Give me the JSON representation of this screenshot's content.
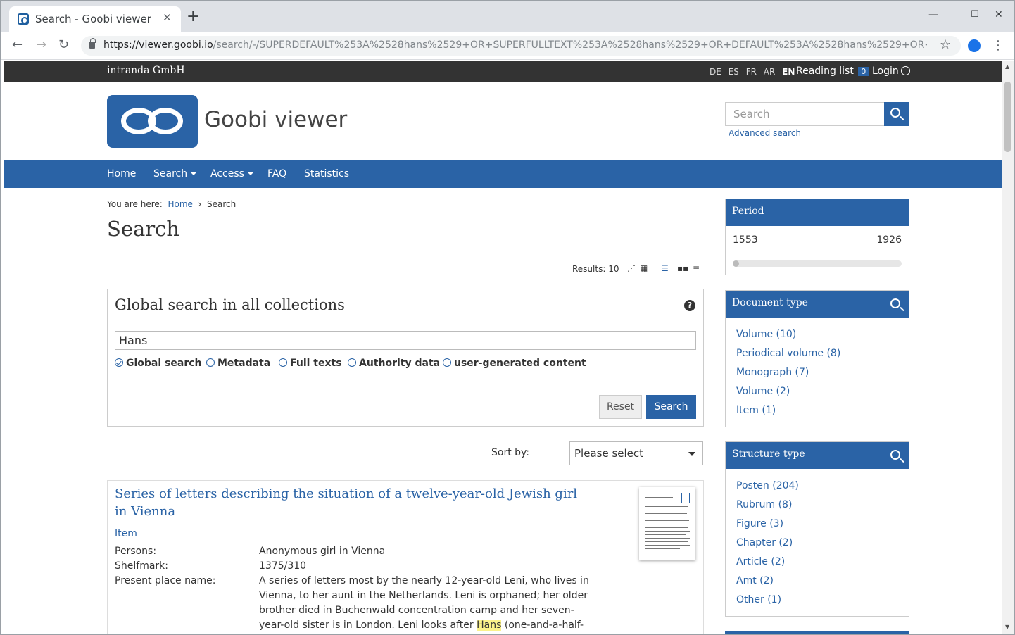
{
  "browser": {
    "tab_title": "Search - Goobi viewer",
    "url_host": "https://viewer.goobi.io",
    "url_path": "/search/-/SUPERDEFAULT%253A%2528hans%2529+OR+SUPERFULLTEXT%253A%2528hans%2529+OR+DEFAULT%253A%2528hans%2529+OR+FULLTEXT%253A%2..."
  },
  "topbar": {
    "brand": "intranda GmbH",
    "languages": [
      "DE",
      "ES",
      "FR",
      "AR",
      "EN"
    ],
    "active_language": "EN",
    "reading_list_label": "Reading list",
    "reading_list_count": "0",
    "login_label": "Login"
  },
  "header": {
    "site_name": "Goobi viewer",
    "search_placeholder": "Search",
    "advanced_search": "Advanced search"
  },
  "nav": {
    "items": [
      "Home",
      "Search",
      "Access",
      "FAQ",
      "Statistics"
    ]
  },
  "breadcrumb": {
    "prefix": "You are here:",
    "home": "Home",
    "separator": "›",
    "current": "Search"
  },
  "page_title": "Search",
  "results_label": "Results: 10",
  "search_box": {
    "title": "Global search in all collections",
    "query": "Hans",
    "options": [
      "Global search",
      "Metadata",
      "Full texts",
      "Authority data",
      "user-generated content"
    ],
    "selected": "Global search",
    "reset_label": "Reset",
    "search_label": "Search"
  },
  "sort": {
    "label": "Sort by:",
    "value": "Please select"
  },
  "result": {
    "title": "Series of letters describing the situation of a twelve-year-old Jewish girl in Vienna",
    "type": "Item",
    "persons_label": "Persons:",
    "persons": "Anonymous girl in Vienna",
    "shelfmark_label": "Shelfmark:",
    "shelfmark": "1375/310",
    "place_label": "Present place name:",
    "place_text": "A series of letters most by the nearly 12-year-old Leni, who lives in Vienna, to her aunt in the Netherlands. Leni is orphaned; her older brother died in Buchenwald concentration camp and her seven-year-old sister is in London. Leni looks after",
    "place_highlight": "Hans",
    "place_after": "(one-and-a-half-"
  },
  "sidebar": {
    "period": {
      "title": "Period",
      "min": "1553",
      "max": "1926"
    },
    "document_type": {
      "title": "Document type",
      "items": [
        "Volume (10)",
        "Periodical volume (8)",
        "Monograph (7)",
        "Volume (2)",
        "Item (1)"
      ]
    },
    "structure_type": {
      "title": "Structure type",
      "items": [
        "Posten (204)",
        "Rubrum (8)",
        "Figure (3)",
        "Chapter (2)",
        "Article (2)",
        "Amt (2)",
        "Other (1)"
      ]
    }
  },
  "colors": {
    "brand_blue": "#2a63a6",
    "topbar": "#333333",
    "highlight": "#fbf28a"
  }
}
